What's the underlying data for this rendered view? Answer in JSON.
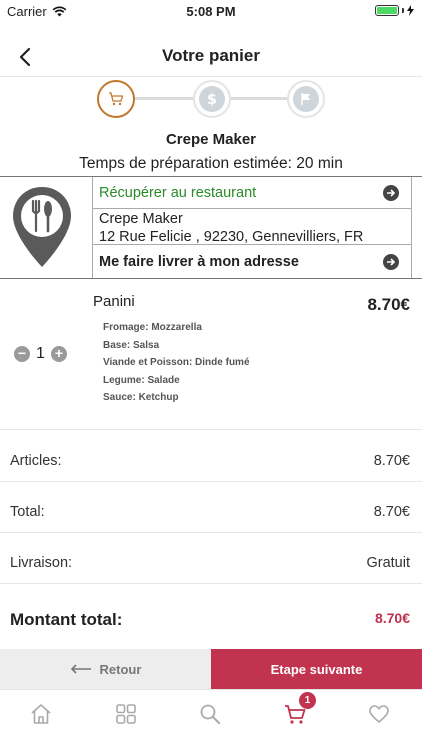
{
  "status_bar": {
    "carrier": "Carrier",
    "time": "5:08 PM"
  },
  "header": {
    "title": "Votre panier"
  },
  "stepper": {
    "steps": [
      "cart-icon",
      "dollar-icon",
      "flag-icon"
    ],
    "active_index": 0
  },
  "restaurant": {
    "name": "Crepe Maker",
    "prep_time": "Temps de préparation estimée: 20 min"
  },
  "delivery": {
    "pickup_label": "Récupérer au restaurant",
    "address_name": "Crepe Maker",
    "address_line": "12 Rue Felicie , 92230, Gennevilliers, FR",
    "deliver_label": "Me faire livrer à mon adresse"
  },
  "item": {
    "name": "Panini",
    "price": "8.70€",
    "quantity": "1",
    "options": [
      "Fromage: Mozzarella",
      "Base: Salsa",
      "Viande et Poisson: Dinde fumé",
      "Legume: Salade",
      "Sauce: Ketchup"
    ]
  },
  "summary": {
    "articles_label": "Articles:",
    "articles_value": "8.70€",
    "total_label": "Total:",
    "total_value": "8.70€",
    "delivery_label": "Livraison:",
    "delivery_value": "Gratuit",
    "grand_total_label": "Montant total:",
    "grand_total_value": "8.70€"
  },
  "buttons": {
    "back": "Retour",
    "next": "Etape suivante"
  },
  "tabbar": {
    "cart_badge": "1",
    "tabs": [
      "home-icon",
      "grid-icon",
      "search-icon",
      "cart-icon",
      "heart-icon"
    ]
  },
  "colors": {
    "accent": "#c1334f",
    "pickup_green": "#2a8a2a",
    "step_active": "#c0782f"
  }
}
